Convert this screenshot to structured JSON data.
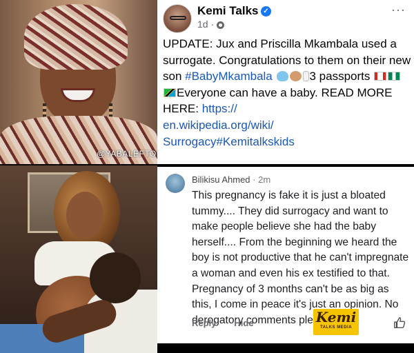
{
  "photo": {
    "watermark": "@YABALEFTONLINE"
  },
  "post": {
    "page_name": "Kemi Talks",
    "time": "1d",
    "more_label": "···",
    "text_parts": {
      "p1": "UPDATE: Jux and Priscilla Mkambala used a surrogate. Congratulations to them on their new son ",
      "hashtag": "#BabyMkambala",
      "p2": "3 passports ",
      "p3": "Everyone can have a baby. READ MORE HERE: ",
      "link": "https://en.wikipedia.org/wiki/Surrogacy#Kemitalkskids"
    },
    "link_lines": [
      "https://",
      "en.wikipedia.org/wiki/",
      "Surrogacy#Kemitalkskids"
    ]
  },
  "comment": {
    "author": "Bilikisu Ahmed",
    "time": "2m",
    "text": "This pregnancy is fake it is just a bloated tummy.... They did surrogacy and want to make people believe she had the baby herself.... From the beginning we heard the boy is not productive that he can't impregnate a woman and even his ex testified to that. Pregnancy of 3 months can't be as big as this, I come in peace it's just an opinion. No derogatory comments please.",
    "reply_label": "Reply",
    "hide_label": "Hide"
  },
  "logo": {
    "main": "Kemi",
    "sub": "TALKS MEDIA"
  },
  "colors": {
    "link": "#1a58b8",
    "verified": "#1877f2",
    "logo_bg": "#f6c400"
  }
}
